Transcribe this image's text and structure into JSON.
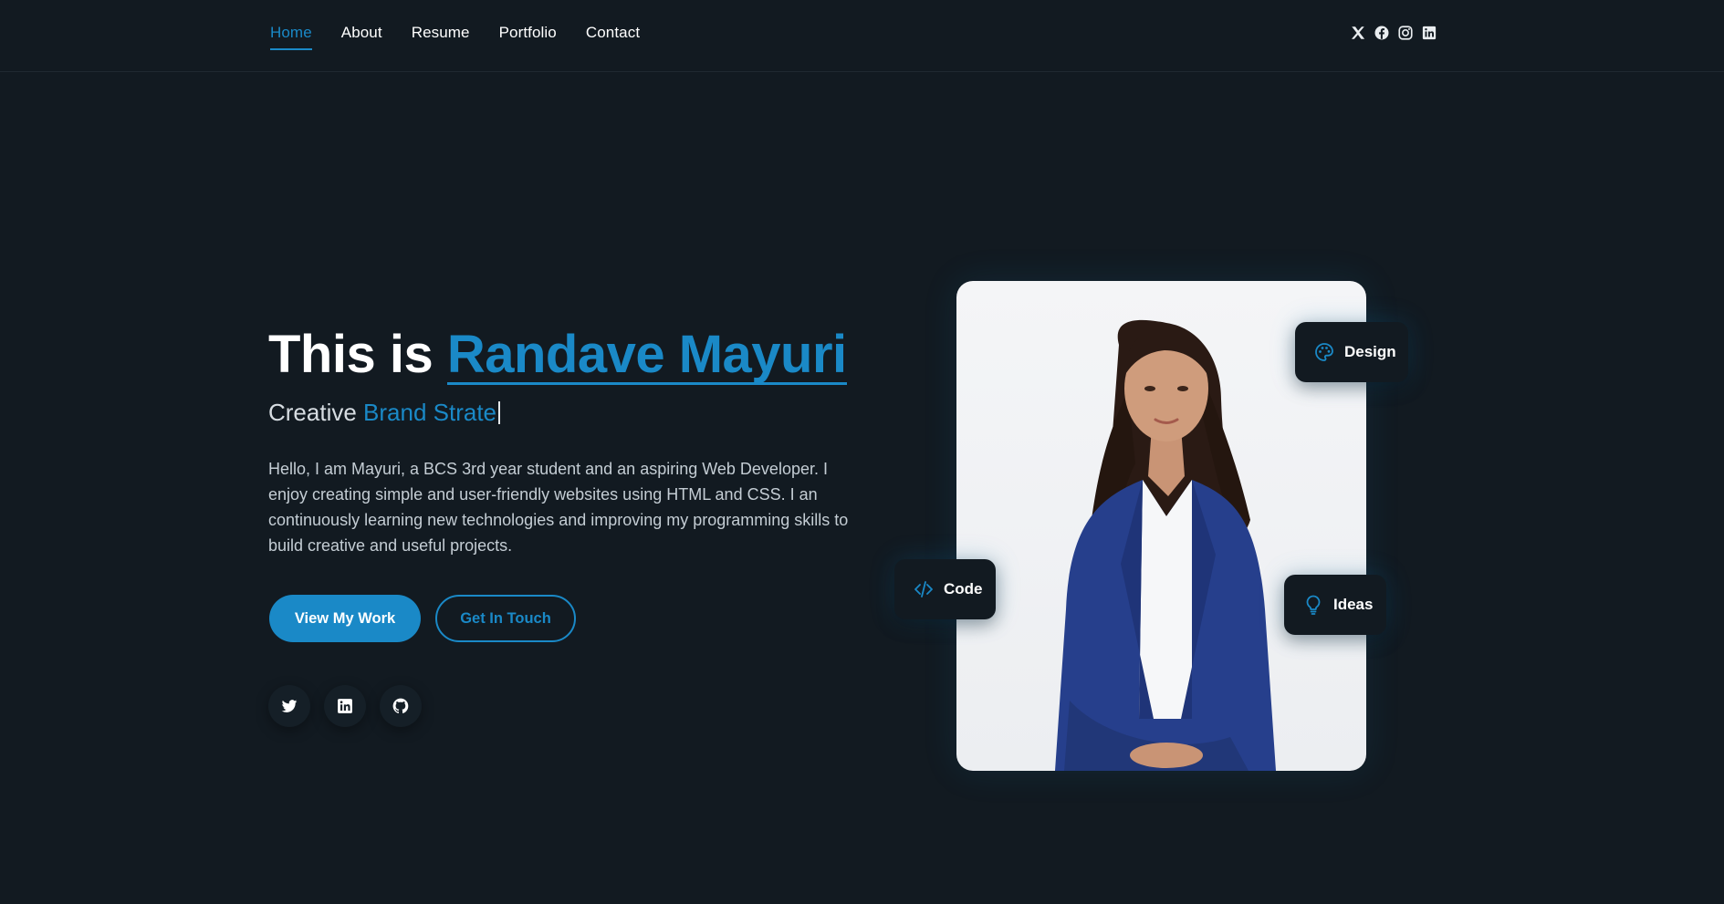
{
  "nav": {
    "items": [
      {
        "label": "Home",
        "active": true
      },
      {
        "label": "About",
        "active": false
      },
      {
        "label": "Resume",
        "active": false
      },
      {
        "label": "Portfolio",
        "active": false
      },
      {
        "label": "Contact",
        "active": false
      }
    ]
  },
  "header_socials": [
    "x-icon",
    "facebook-icon",
    "instagram-icon",
    "linkedin-icon"
  ],
  "hero": {
    "title_prefix": "This is ",
    "name": "Randave Mayuri",
    "subtitle_prefix": "Creative ",
    "subtitle_typed": "Brand Strate",
    "description": "Hello, I am Mayuri, a BCS 3rd year student and an aspiring Web Developer. I enjoy creating simple and user-friendly websites using HTML and CSS. I an continuously learning new technologies and improving my programming skills to build creative and useful projects.",
    "primary_button": "View My Work",
    "secondary_button": "Get In Touch"
  },
  "hero_socials": [
    "twitter-icon",
    "linkedin-icon",
    "github-icon"
  ],
  "badges": {
    "design": "Design",
    "code": "Code",
    "ideas": "Ideas"
  },
  "colors": {
    "background": "#121a21",
    "accent": "#1a89c7",
    "text": "#ffffff",
    "muted_text": "#c4cdd4",
    "suit": "#263f8c"
  }
}
